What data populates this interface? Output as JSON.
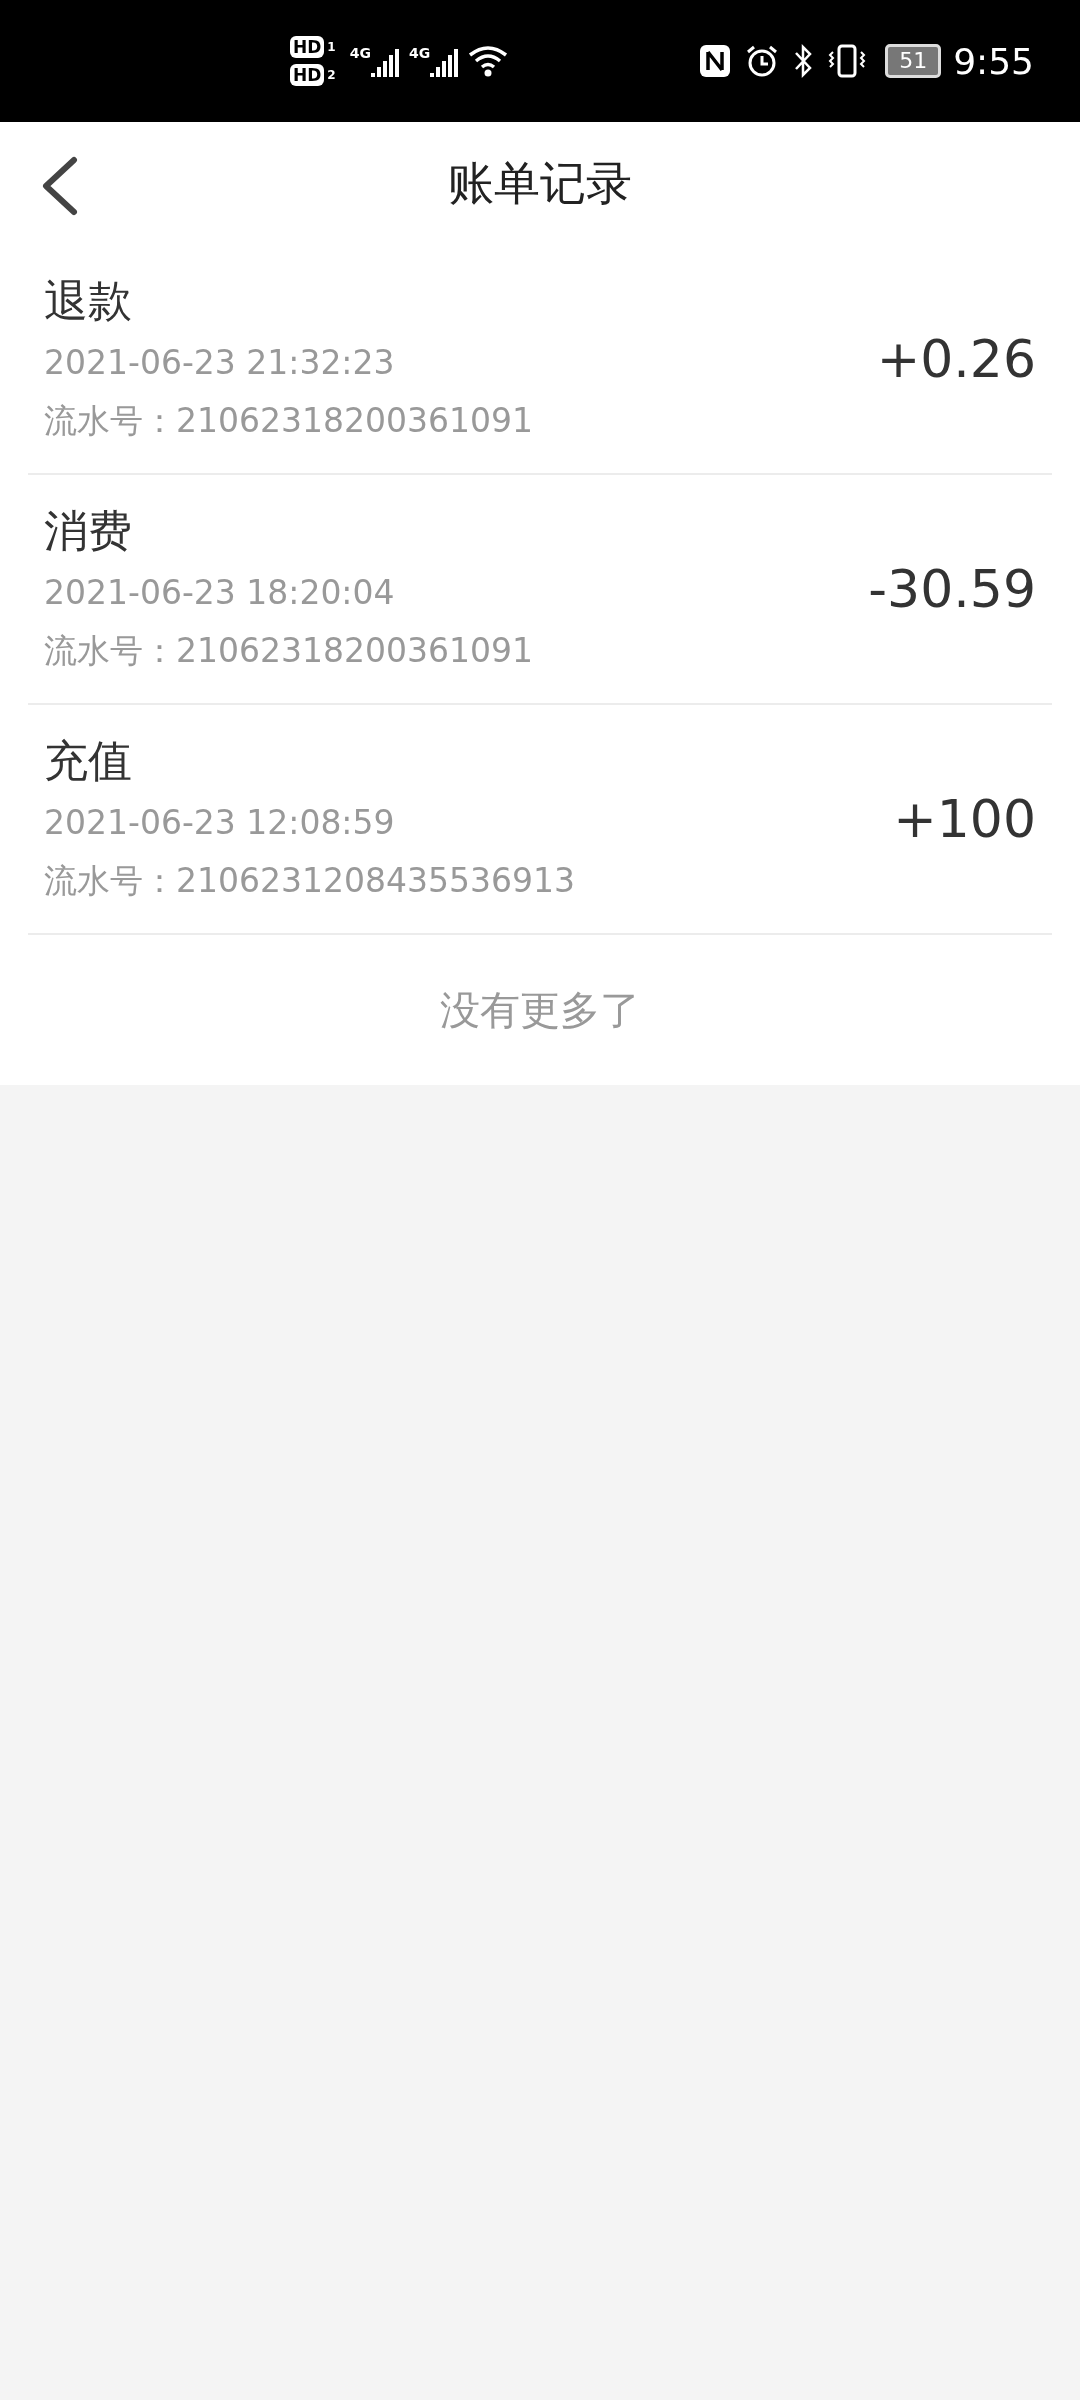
{
  "status_bar": {
    "sims": [
      {
        "badge": "HD",
        "slot": "1",
        "network": "4G"
      },
      {
        "badge": "HD",
        "slot": "2",
        "network": "4G"
      }
    ],
    "battery": "51",
    "time": "9:55"
  },
  "header": {
    "title": "账单记录"
  },
  "records": [
    {
      "type": "退款",
      "time": "2021-06-23 21:32:23",
      "serial_label": "流水号：",
      "serial": "21062318200361091",
      "amount": "+0.26"
    },
    {
      "type": "消费",
      "time": "2021-06-23 18:20:04",
      "serial_label": "流水号：",
      "serial": "21062318200361091",
      "amount": "-30.59"
    },
    {
      "type": "充值",
      "time": "2021-06-23 12:08:59",
      "serial_label": "流水号：",
      "serial": "2106231208435536913",
      "amount": "+100"
    }
  ],
  "footer": "没有更多了"
}
